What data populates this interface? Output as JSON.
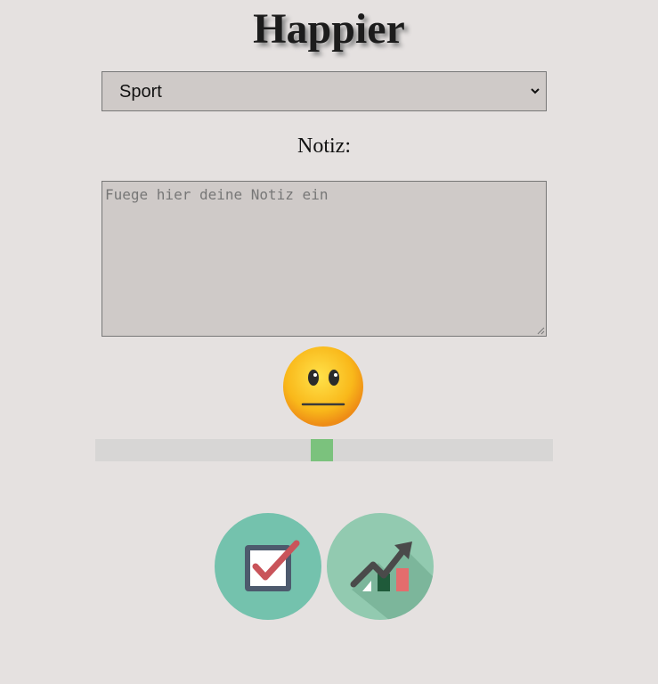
{
  "app": {
    "title": "Happier"
  },
  "category_select": {
    "selected": "Sport"
  },
  "note": {
    "label": "Notiz:",
    "value": "",
    "placeholder": "Fuege hier deine Notiz ein"
  },
  "mood": {
    "icon": "neutral-face-emoji",
    "slider_value_fraction": 0.5
  },
  "actions": {
    "save_icon": "checkbox-check-icon",
    "stats_icon": "trend-chart-icon"
  },
  "colors": {
    "background": "#e5e1e0",
    "field_background": "#cfcac8",
    "slider_thumb": "#7bc27d",
    "save_button": "#74c2ad",
    "stats_button": "#92cab0"
  }
}
